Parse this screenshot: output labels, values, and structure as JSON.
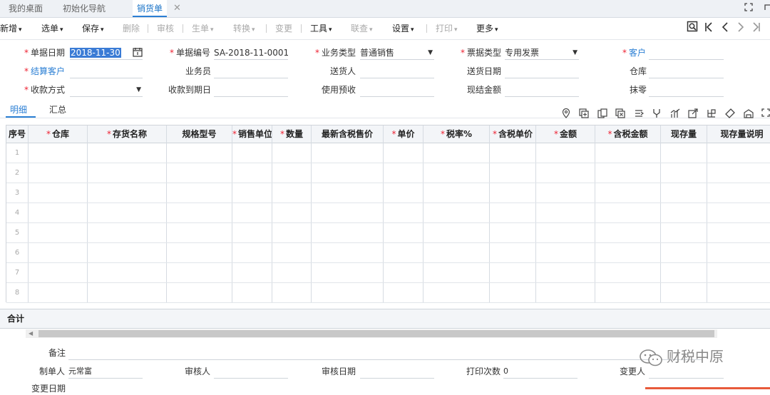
{
  "tabs": [
    {
      "label": "我的桌面"
    },
    {
      "label": "初始化导航"
    },
    {
      "label": "销货单"
    }
  ],
  "tab_close": "✕",
  "toolbar": [
    {
      "label": "新增",
      "caret": "▾",
      "disabled": false
    },
    {
      "label": "选单",
      "caret": "▾",
      "disabled": false
    },
    {
      "label": "保存",
      "caret": "▾",
      "disabled": false
    },
    {
      "label": "删除",
      "caret": "",
      "disabled": true
    },
    {
      "label": "审核",
      "caret": "",
      "disabled": true
    },
    {
      "label": "生单",
      "caret": "▾",
      "disabled": true
    },
    {
      "label": "转换",
      "caret": "▾",
      "disabled": true
    },
    {
      "label": "变更",
      "caret": "",
      "disabled": true
    },
    {
      "label": "工具",
      "caret": "▾",
      "disabled": false
    },
    {
      "label": "联查",
      "caret": "▾",
      "disabled": true
    },
    {
      "label": "设置",
      "caret": "▾",
      "disabled": false
    },
    {
      "label": "打印",
      "caret": "▾",
      "disabled": true
    },
    {
      "label": "更多",
      "caret": "▾",
      "disabled": false
    }
  ],
  "form": {
    "doc_date": {
      "label": "单据日期",
      "value": "2018-11-30"
    },
    "doc_no": {
      "label": "单据编号",
      "value": "SA-2018-11-0001"
    },
    "biz_type": {
      "label": "业务类型",
      "value": "普通销售"
    },
    "invoice_type": {
      "label": "票据类型",
      "value": "专用发票"
    },
    "customer": {
      "label": "客户",
      "value": ""
    },
    "settle_customer": {
      "label": "结算客户",
      "value": ""
    },
    "salesman": {
      "label": "业务员",
      "value": ""
    },
    "deliverer": {
      "label": "送货人",
      "value": ""
    },
    "delivery_date": {
      "label": "送货日期",
      "value": ""
    },
    "warehouse": {
      "label": "仓库",
      "value": ""
    },
    "payment_method": {
      "label": "收款方式",
      "value": ""
    },
    "due_date": {
      "label": "收款到期日",
      "value": ""
    },
    "use_prepay": {
      "label": "使用预收",
      "value": ""
    },
    "cash_amount": {
      "label": "现结金额",
      "value": ""
    },
    "round_off": {
      "label": "抹零",
      "value": ""
    }
  },
  "subtabs": [
    {
      "label": "明细"
    },
    {
      "label": "汇总"
    }
  ],
  "grid": {
    "columns": [
      {
        "label": "序号",
        "required": false
      },
      {
        "label": "仓库",
        "required": true
      },
      {
        "label": "存货名称",
        "required": true
      },
      {
        "label": "规格型号",
        "required": false
      },
      {
        "label": "销售单位",
        "required": true
      },
      {
        "label": "数量",
        "required": true
      },
      {
        "label": "最新含税售价",
        "required": false
      },
      {
        "label": "单价",
        "required": true
      },
      {
        "label": "税率%",
        "required": true
      },
      {
        "label": "含税单价",
        "required": true
      },
      {
        "label": "金额",
        "required": true
      },
      {
        "label": "含税金额",
        "required": true
      },
      {
        "label": "现存量",
        "required": false
      },
      {
        "label": "现存量说明",
        "required": false
      }
    ],
    "rows": [
      "1",
      "2",
      "3",
      "4",
      "5",
      "6",
      "7",
      "8"
    ]
  },
  "total_label": "合计",
  "footer": {
    "remark": {
      "label": "备注",
      "value": ""
    },
    "creator": {
      "label": "制单人",
      "value": "元常富"
    },
    "auditor": {
      "label": "审核人",
      "value": ""
    },
    "audit_date": {
      "label": "审核日期",
      "value": ""
    },
    "print_count": {
      "label": "打印次数",
      "value": "0"
    },
    "modifier": {
      "label": "变更人",
      "value": ""
    },
    "modify_date": {
      "label": "变更日期",
      "value": ""
    }
  },
  "watermark": "财税中原",
  "required_mark": "*",
  "colors": {
    "accent": "#2b7fd4",
    "required": "#e23333",
    "selection": "#3a7bd5"
  }
}
